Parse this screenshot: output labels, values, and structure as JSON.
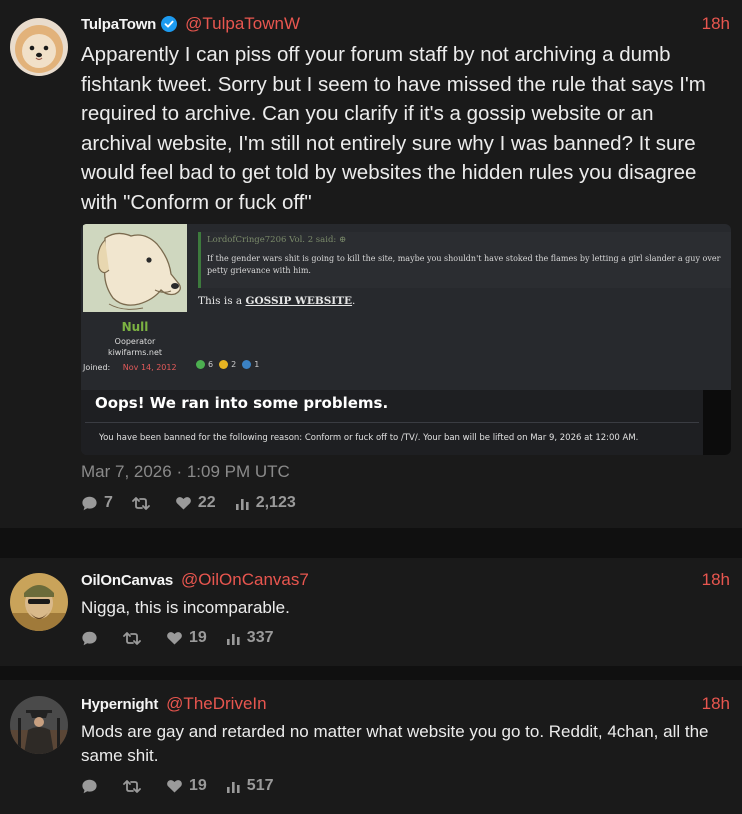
{
  "colors": {
    "accent": "#e8564f",
    "background": "#1a1a1a",
    "verified": "#1d9bf0"
  },
  "tweets": [
    {
      "author": "TulpaTown",
      "handle": "@TulpaTownW",
      "time": "18h",
      "verified": true,
      "text": "Apparently I can piss off your forum staff by not archiving a dumb fishtank tweet. Sorry but I seem to have missed the rule that says I'm required to archive. Can you clarify if it's a gossip website or an archival website, I'm still not entirely sure why I was banned? It sure would feel bad to get told by websites the hidden rules you disagree with \"Conform or fuck off\"",
      "date": "Mar 7, 2026 · 1:09 PM UTC",
      "replies": "7",
      "retweets": "",
      "likes": "22",
      "views": "2,123",
      "embed": {
        "username": "Null",
        "user_title": "Ooperator",
        "user_site": "kiwifarms.net",
        "joined_label": "Joined:",
        "joined_date": "Nov 14, 2012",
        "quote_author": "LordofCringe7206 Vol. 2 said: ⊕",
        "quote_body": "If the gender wars shit is going to kill the site, maybe you shouldn't have stoked the flames by letting a girl slander a guy over petty grievance with him.",
        "message_prefix": "This is a ",
        "message_emphasis": "GOSSIP WEBSITE",
        "message_suffix": ".",
        "reactions": [
          {
            "count": "6"
          },
          {
            "count": "2"
          },
          {
            "count": "1"
          }
        ],
        "error_title": "Oops! We ran into some problems.",
        "ban_message": "You have been banned for the following reason: Conform or fuck off to /TV/. Your ban will be lifted on Mar 9, 2026 at 12:00 AM."
      }
    },
    {
      "author": "OilOnCanvas",
      "handle": "@OilOnCanvas7",
      "time": "18h",
      "text": "Nigga, this is incomparable.",
      "replies": "",
      "retweets": "",
      "likes": "19",
      "views": "337"
    },
    {
      "author": "Hypernight",
      "handle": "@TheDriveIn",
      "time": "18h",
      "text": "Mods are gay and retarded no matter what website you go to. Reddit, 4chan, all the same shit.",
      "replies": "",
      "retweets": "",
      "likes": "19",
      "views": "517"
    }
  ]
}
